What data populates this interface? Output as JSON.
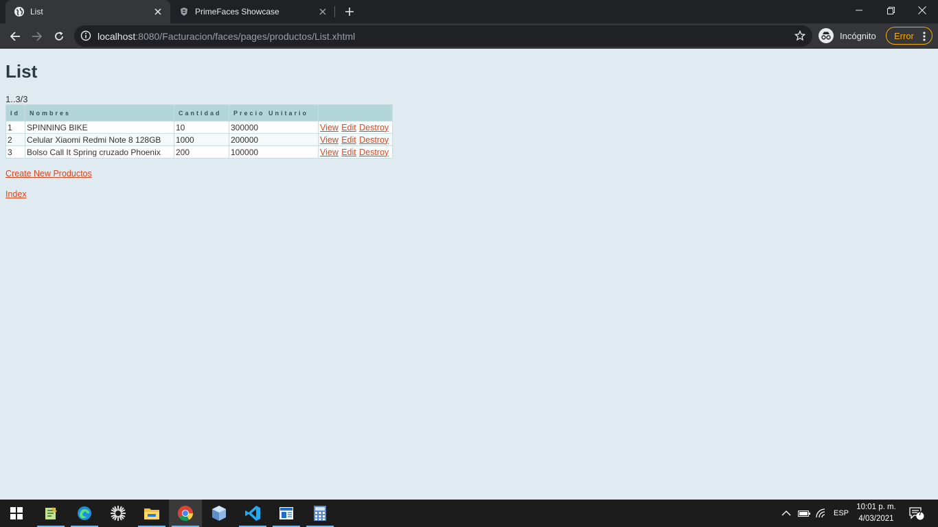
{
  "browser": {
    "tabs": [
      {
        "title": "List",
        "active": true
      },
      {
        "title": "PrimeFaces Showcase",
        "active": false
      }
    ],
    "url_host": "localhost",
    "url_rest": ":8080/Facturacion/faces/pages/productos/List.xhtml",
    "incognito_label": "Incógnito",
    "error_label": "Error"
  },
  "page": {
    "title": "List",
    "range_text": "1..3/3",
    "table": {
      "headers": [
        "Id",
        "Nombres",
        "Cantidad",
        "Precio Unitario",
        ""
      ],
      "rows": [
        {
          "id": "1",
          "nombre": "SPINNING BIKE",
          "cantidad": "10",
          "precio": "300000"
        },
        {
          "id": "2",
          "nombre": "Celular Xiaomi Redmi Note 8 128GB",
          "cantidad": "1000",
          "precio": "200000"
        },
        {
          "id": "3",
          "nombre": "Bolso Call It Spring cruzado Phoenix",
          "cantidad": "200",
          "precio": "100000"
        }
      ],
      "action_labels": {
        "view": "View",
        "edit": "Edit",
        "destroy": "Destroy"
      }
    },
    "create_link": "Create New Productos",
    "index_link": "Index"
  },
  "taskbar": {
    "apps": [
      "start-icon",
      "notepad-plus-icon",
      "edge-icon",
      "settings-gear-icon",
      "file-explorer-icon",
      "chrome-icon",
      "cube-app-icon",
      "vscode-icon",
      "outlook-icon",
      "calculator-icon"
    ],
    "language": "ESP",
    "time": "10:01 p. m.",
    "date": "4/03/2021",
    "notification_count": "7"
  },
  "colors": {
    "page_bg": "#dfebf0",
    "link": "#d9471e",
    "header_bg": "#b3d6d8",
    "error_badge": "#f9ab00"
  }
}
